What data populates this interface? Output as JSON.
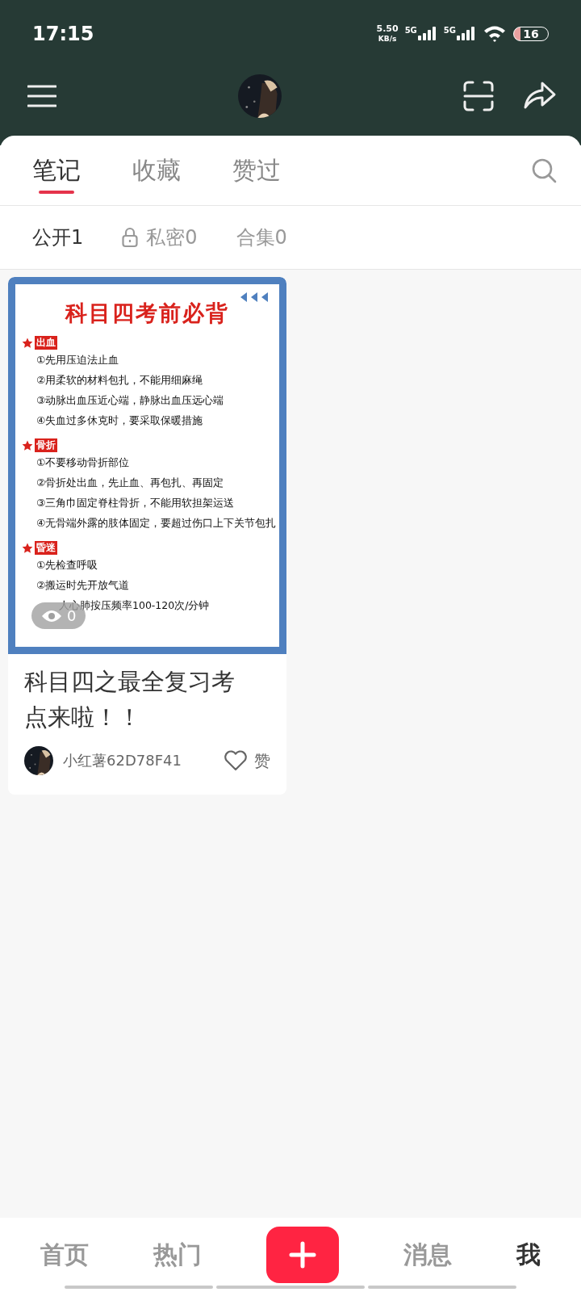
{
  "status_bar": {
    "time": "17:15",
    "speed": "5.50",
    "speed_unit": "KB/s",
    "sim1": "5G",
    "sim2": "5G",
    "battery": "16"
  },
  "tabs": [
    {
      "label": "笔记",
      "selected": true
    },
    {
      "label": "收藏",
      "selected": false
    },
    {
      "label": "赞过",
      "selected": false
    }
  ],
  "subtabs": [
    {
      "label": "公开1",
      "selected": true,
      "locked": false
    },
    {
      "label": "私密0",
      "selected": false,
      "locked": true
    },
    {
      "label": "合集0",
      "selected": false,
      "locked": false
    }
  ],
  "notes": [
    {
      "cover": {
        "title": "科目四考前必背",
        "sections": [
          {
            "heading": "出血",
            "lines": [
              "①先用压迫法止血",
              "②用柔软的材料包扎，不能用细麻绳",
              "③动脉出血压近心端，静脉出血压远心端",
              "④失血过多休克时，要采取保暖措施"
            ]
          },
          {
            "heading": "骨折",
            "lines": [
              "①不要移动骨折部位",
              "②骨折处出血，先止血、再包扎、再固定",
              "③三角巾固定脊柱骨折，不能用软担架运送",
              "④无骨端外露的肢体固定，要超过伤口上下关节包扎"
            ]
          },
          {
            "heading": "昏迷",
            "lines": [
              "①先检查呼吸",
              "②搬运时先开放气道",
              "人心肺按压频率100-120次/分钟"
            ]
          }
        ]
      },
      "views": "0",
      "title": "科目四之最全复习考点来啦！！",
      "author": "小红薯62D78F41",
      "like_label": "赞",
      "liked": false
    }
  ],
  "bottom_nav": [
    {
      "label": "首页",
      "selected": false,
      "kind": "text"
    },
    {
      "label": "热门",
      "selected": false,
      "kind": "text"
    },
    {
      "kind": "add"
    },
    {
      "label": "消息",
      "selected": false,
      "kind": "text"
    },
    {
      "label": "我",
      "selected": true,
      "kind": "text"
    }
  ]
}
